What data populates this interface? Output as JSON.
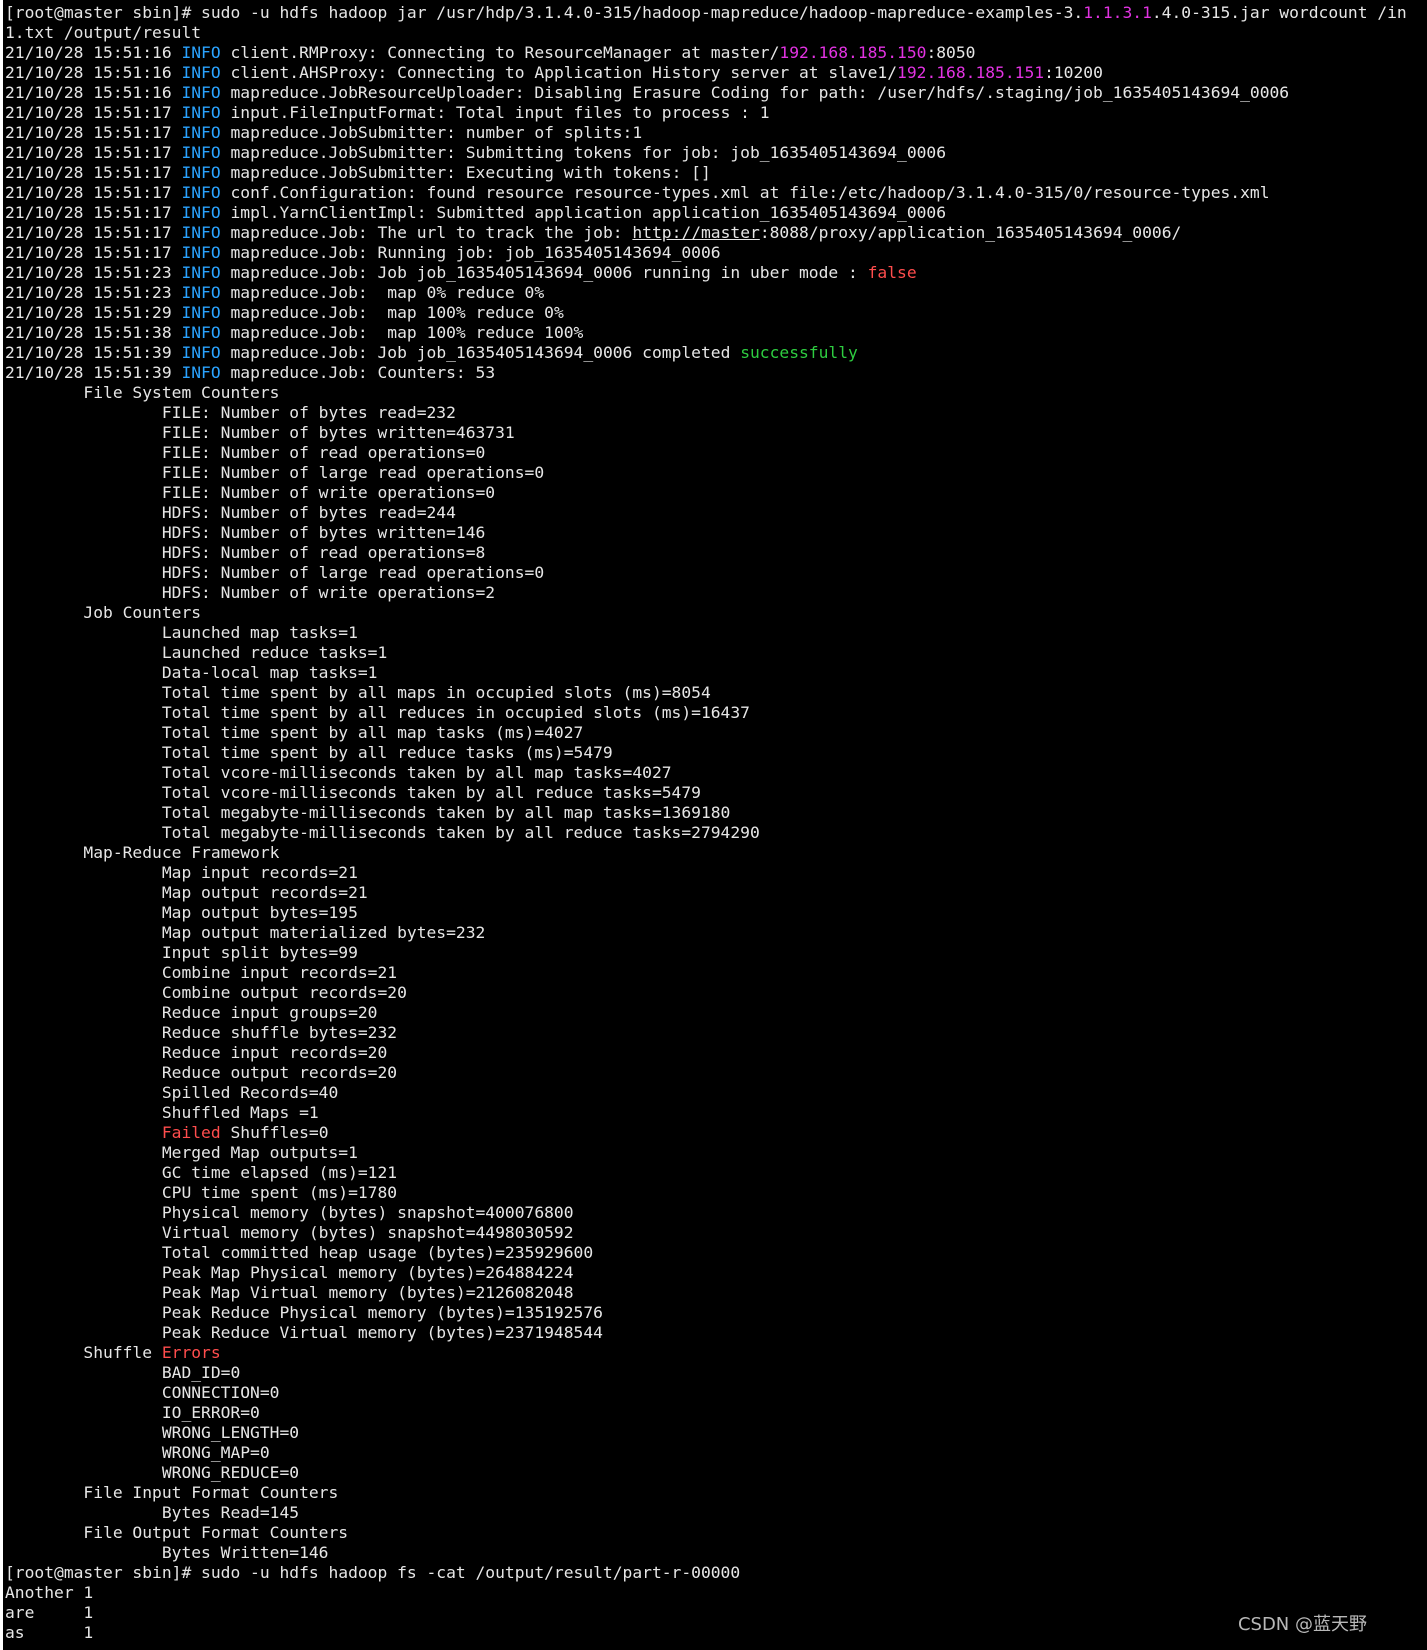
{
  "watermark": "CSDN @蓝天野",
  "colors": {
    "background": "#000000",
    "text": "#e6e6e6",
    "info": "#2aa3ff",
    "ip": "#e233e2",
    "false": "#ff4d4d",
    "success": "#2ecc40",
    "error": "#ff4d4d"
  },
  "lines": [
    [
      {
        "t": "[root@master sbin]# sudo -u hdfs hadoop jar /usr/hdp/3.1.4.0-315/hadoop-mapreduce/hadoop-mapreduce-examples-3."
      },
      {
        "t": "1.1.3.1",
        "c": "ver"
      },
      {
        "t": ".4.0-315.jar wordcount /in"
      }
    ],
    [
      {
        "t": "1.txt /output/result"
      }
    ],
    [
      {
        "t": "21/10/28 15:51:16 "
      },
      {
        "t": "INFO",
        "c": "info"
      },
      {
        "t": " client.RMProxy: Connecting to ResourceManager at master/"
      },
      {
        "t": "192.168.185.150",
        "c": "ip"
      },
      {
        "t": ":8050"
      }
    ],
    [
      {
        "t": "21/10/28 15:51:16 "
      },
      {
        "t": "INFO",
        "c": "info"
      },
      {
        "t": " client.AHSProxy: Connecting to Application History server at slave1/"
      },
      {
        "t": "192.168.185.151",
        "c": "ip"
      },
      {
        "t": ":10200"
      }
    ],
    [
      {
        "t": "21/10/28 15:51:16 "
      },
      {
        "t": "INFO",
        "c": "info"
      },
      {
        "t": " mapreduce.JobResourceUploader: Disabling Erasure Coding for path: /user/hdfs/.staging/job_1635405143694_0006"
      }
    ],
    [
      {
        "t": "21/10/28 15:51:17 "
      },
      {
        "t": "INFO",
        "c": "info"
      },
      {
        "t": " input.FileInputFormat: Total input files to process : 1"
      }
    ],
    [
      {
        "t": "21/10/28 15:51:17 "
      },
      {
        "t": "INFO",
        "c": "info"
      },
      {
        "t": " mapreduce.JobSubmitter: number of splits:1"
      }
    ],
    [
      {
        "t": "21/10/28 15:51:17 "
      },
      {
        "t": "INFO",
        "c": "info"
      },
      {
        "t": " mapreduce.JobSubmitter: Submitting tokens for job: job_1635405143694_0006"
      }
    ],
    [
      {
        "t": "21/10/28 15:51:17 "
      },
      {
        "t": "INFO",
        "c": "info"
      },
      {
        "t": " mapreduce.JobSubmitter: Executing with tokens: []"
      }
    ],
    [
      {
        "t": "21/10/28 15:51:17 "
      },
      {
        "t": "INFO",
        "c": "info"
      },
      {
        "t": " conf.Configuration: found resource resource-types.xml at file:/etc/hadoop/3.1.4.0-315/0/resource-types.xml"
      }
    ],
    [
      {
        "t": "21/10/28 15:51:17 "
      },
      {
        "t": "INFO",
        "c": "info"
      },
      {
        "t": " impl.YarnClientImpl: Submitted application application_1635405143694_0006"
      }
    ],
    [
      {
        "t": "21/10/28 15:51:17 "
      },
      {
        "t": "INFO",
        "c": "info"
      },
      {
        "t": " mapreduce.Job: The url to track the job: "
      },
      {
        "t": "http://master",
        "c": "url"
      },
      {
        "t": ":8088/proxy/application_1635405143694_0006/"
      }
    ],
    [
      {
        "t": "21/10/28 15:51:17 "
      },
      {
        "t": "INFO",
        "c": "info"
      },
      {
        "t": " mapreduce.Job: Running job: job_1635405143694_0006"
      }
    ],
    [
      {
        "t": "21/10/28 15:51:23 "
      },
      {
        "t": "INFO",
        "c": "info"
      },
      {
        "t": " mapreduce.Job: Job job_1635405143694_0006 running in uber mode : "
      },
      {
        "t": "false",
        "c": "false"
      }
    ],
    [
      {
        "t": "21/10/28 15:51:23 "
      },
      {
        "t": "INFO",
        "c": "info"
      },
      {
        "t": " mapreduce.Job:  map 0% reduce 0%"
      }
    ],
    [
      {
        "t": "21/10/28 15:51:29 "
      },
      {
        "t": "INFO",
        "c": "info"
      },
      {
        "t": " mapreduce.Job:  map 100% reduce 0%"
      }
    ],
    [
      {
        "t": "21/10/28 15:51:38 "
      },
      {
        "t": "INFO",
        "c": "info"
      },
      {
        "t": " mapreduce.Job:  map 100% reduce 100%"
      }
    ],
    [
      {
        "t": "21/10/28 15:51:39 "
      },
      {
        "t": "INFO",
        "c": "info"
      },
      {
        "t": " mapreduce.Job: Job job_1635405143694_0006 completed "
      },
      {
        "t": "successfully",
        "c": "success"
      }
    ],
    [
      {
        "t": "21/10/28 15:51:39 "
      },
      {
        "t": "INFO",
        "c": "info"
      },
      {
        "t": " mapreduce.Job: Counters: 53"
      }
    ],
    [
      {
        "t": "        File System Counters"
      }
    ],
    [
      {
        "t": "                FILE: Number of bytes read=232"
      }
    ],
    [
      {
        "t": "                FILE: Number of bytes written=463731"
      }
    ],
    [
      {
        "t": "                FILE: Number of read operations=0"
      }
    ],
    [
      {
        "t": "                FILE: Number of large read operations=0"
      }
    ],
    [
      {
        "t": "                FILE: Number of write operations=0"
      }
    ],
    [
      {
        "t": "                HDFS: Number of bytes read=244"
      }
    ],
    [
      {
        "t": "                HDFS: Number of bytes written=146"
      }
    ],
    [
      {
        "t": "                HDFS: Number of read operations=8"
      }
    ],
    [
      {
        "t": "                HDFS: Number of large read operations=0"
      }
    ],
    [
      {
        "t": "                HDFS: Number of write operations=2"
      }
    ],
    [
      {
        "t": "        Job Counters"
      }
    ],
    [
      {
        "t": "                Launched map tasks=1"
      }
    ],
    [
      {
        "t": "                Launched reduce tasks=1"
      }
    ],
    [
      {
        "t": "                Data-local map tasks=1"
      }
    ],
    [
      {
        "t": "                Total time spent by all maps in occupied slots (ms)=8054"
      }
    ],
    [
      {
        "t": "                Total time spent by all reduces in occupied slots (ms)=16437"
      }
    ],
    [
      {
        "t": "                Total time spent by all map tasks (ms)=4027"
      }
    ],
    [
      {
        "t": "                Total time spent by all reduce tasks (ms)=5479"
      }
    ],
    [
      {
        "t": "                Total vcore-milliseconds taken by all map tasks=4027"
      }
    ],
    [
      {
        "t": "                Total vcore-milliseconds taken by all reduce tasks=5479"
      }
    ],
    [
      {
        "t": "                Total megabyte-milliseconds taken by all map tasks=1369180"
      }
    ],
    [
      {
        "t": "                Total megabyte-milliseconds taken by all reduce tasks=2794290"
      }
    ],
    [
      {
        "t": "        Map-Reduce Framework"
      }
    ],
    [
      {
        "t": "                Map input records=21"
      }
    ],
    [
      {
        "t": "                Map output records=21"
      }
    ],
    [
      {
        "t": "                Map output bytes=195"
      }
    ],
    [
      {
        "t": "                Map output materialized bytes=232"
      }
    ],
    [
      {
        "t": "                Input split bytes=99"
      }
    ],
    [
      {
        "t": "                Combine input records=21"
      }
    ],
    [
      {
        "t": "                Combine output records=20"
      }
    ],
    [
      {
        "t": "                Reduce input groups=20"
      }
    ],
    [
      {
        "t": "                Reduce shuffle bytes=232"
      }
    ],
    [
      {
        "t": "                Reduce input records=20"
      }
    ],
    [
      {
        "t": "                Reduce output records=20"
      }
    ],
    [
      {
        "t": "                Spilled Records=40"
      }
    ],
    [
      {
        "t": "                Shuffled Maps =1"
      }
    ],
    [
      {
        "t": "                "
      },
      {
        "t": "Failed",
        "c": "error"
      },
      {
        "t": " Shuffles=0"
      }
    ],
    [
      {
        "t": "                Merged Map outputs=1"
      }
    ],
    [
      {
        "t": "                GC time elapsed (ms)=121"
      }
    ],
    [
      {
        "t": "                CPU time spent (ms)=1780"
      }
    ],
    [
      {
        "t": "                Physical memory (bytes) snapshot=400076800"
      }
    ],
    [
      {
        "t": "                Virtual memory (bytes) snapshot=4498030592"
      }
    ],
    [
      {
        "t": "                Total committed heap usage (bytes)=235929600"
      }
    ],
    [
      {
        "t": "                Peak Map Physical memory (bytes)=264884224"
      }
    ],
    [
      {
        "t": "                Peak Map Virtual memory (bytes)=2126082048"
      }
    ],
    [
      {
        "t": "                Peak Reduce Physical memory (bytes)=135192576"
      }
    ],
    [
      {
        "t": "                Peak Reduce Virtual memory (bytes)=2371948544"
      }
    ],
    [
      {
        "t": "        Shuffle "
      },
      {
        "t": "Errors",
        "c": "error"
      }
    ],
    [
      {
        "t": "                BAD_ID=0"
      }
    ],
    [
      {
        "t": "                CONNECTION=0"
      }
    ],
    [
      {
        "t": "                IO_ERROR=0"
      }
    ],
    [
      {
        "t": "                WRONG_LENGTH=0"
      }
    ],
    [
      {
        "t": "                WRONG_MAP=0"
      }
    ],
    [
      {
        "t": "                WRONG_REDUCE=0"
      }
    ],
    [
      {
        "t": "        File Input Format Counters"
      }
    ],
    [
      {
        "t": "                Bytes Read=145"
      }
    ],
    [
      {
        "t": "        File Output Format Counters"
      }
    ],
    [
      {
        "t": "                Bytes Written=146"
      }
    ],
    [
      {
        "t": "[root@master sbin]# sudo -u hdfs hadoop fs -cat /output/result/part-r-00000"
      }
    ],
    [
      {
        "t": "Another 1"
      }
    ],
    [
      {
        "t": "are     1"
      }
    ],
    [
      {
        "t": "as      1"
      }
    ]
  ]
}
